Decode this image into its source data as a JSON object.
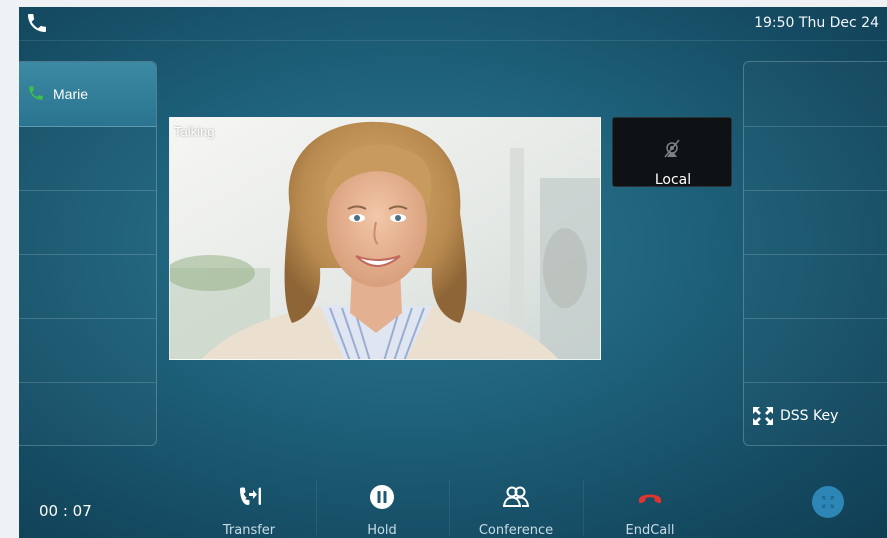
{
  "status_bar": {
    "time": "19:50 Thu Dec 24"
  },
  "left_keys": [
    {
      "label": "Marie",
      "icon": "phone-icon",
      "active": true
    },
    {
      "label": ""
    },
    {
      "label": ""
    },
    {
      "label": ""
    },
    {
      "label": ""
    },
    {
      "label": ""
    }
  ],
  "right_keys": [
    {
      "label": ""
    },
    {
      "label": ""
    },
    {
      "label": ""
    },
    {
      "label": ""
    },
    {
      "label": ""
    },
    {
      "label": "DSS Key",
      "icon": "expand-arrows-icon"
    }
  ],
  "video": {
    "status": "Talking"
  },
  "local_preview": {
    "label": "Local",
    "icon": "camera-off-icon"
  },
  "call": {
    "timer": "00 : 07"
  },
  "softkeys": {
    "transfer": "Transfer",
    "hold": "Hold",
    "conference": "Conference",
    "endcall": "EndCall"
  },
  "colors": {
    "accent": "#2d86b6",
    "active_key": "#3c8aa3",
    "end_call": "#e0342f",
    "call_green": "#3cc04a"
  }
}
